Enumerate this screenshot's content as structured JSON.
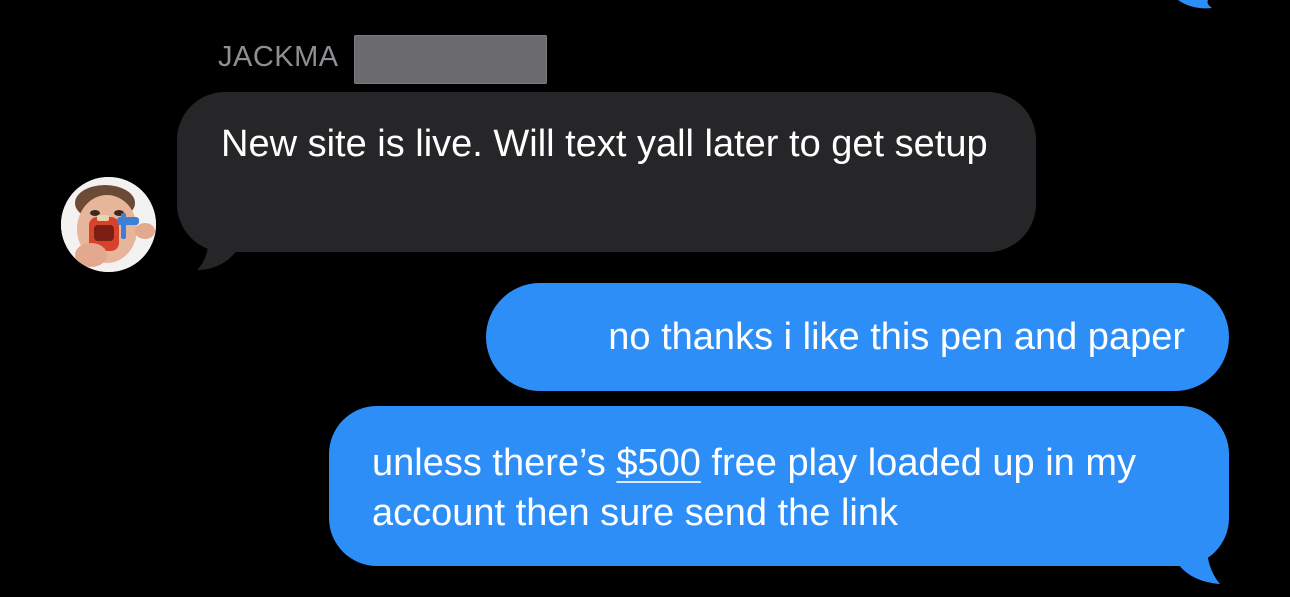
{
  "conversation": {
    "sender_name": "JACKMA",
    "incoming_message": {
      "text": "New site is live. Will text yall later to get setup"
    },
    "outgoing_messages": [
      {
        "text": "no thanks i like this pen and paper"
      },
      {
        "text_before_link": "unless there’s ",
        "link_text": "$500",
        "text_after_link": " free play loaded up in my account then sure send the link"
      }
    ]
  },
  "colors": {
    "background": "#000000",
    "incoming_bubble": "#262628",
    "outgoing_bubble": "#2e8ef8",
    "sender_name": "#8e8e93",
    "redaction": "#6b6b6f"
  },
  "icons": {
    "avatar": "contact-avatar-photo"
  }
}
